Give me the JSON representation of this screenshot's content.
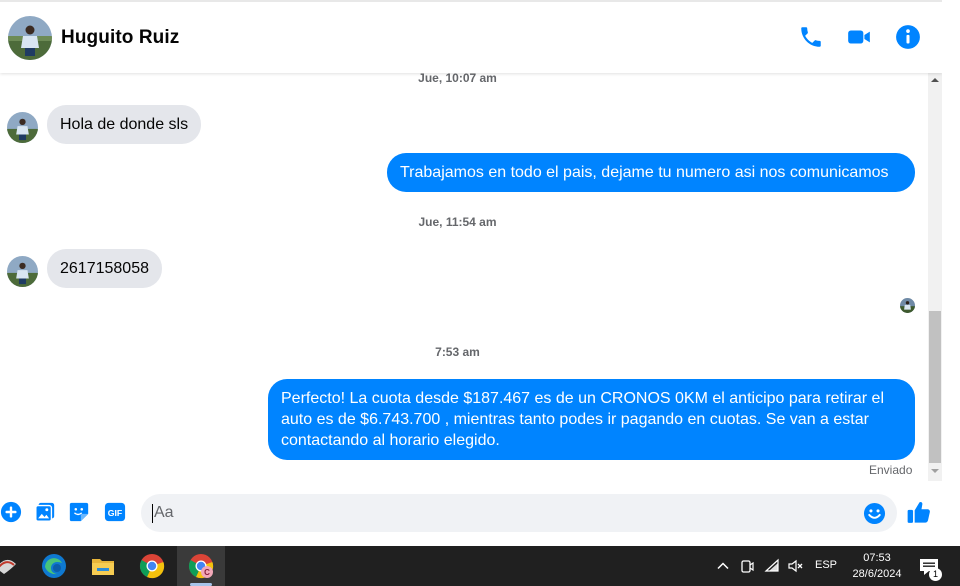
{
  "contact": {
    "name": "Huguito Ruiz"
  },
  "header_actions": [
    {
      "icon": "phone-icon"
    },
    {
      "icon": "video-camera-icon"
    },
    {
      "icon": "info-icon"
    }
  ],
  "messages": [
    {
      "type": "timestamp",
      "text": "Jue, 10:07 am"
    },
    {
      "type": "incoming",
      "text": "Hola de donde sls"
    },
    {
      "type": "outgoing",
      "text": "Trabajamos en todo el pais, dejame tu numero asi nos comunicamos"
    },
    {
      "type": "timestamp",
      "text": "Jue, 11:54 am"
    },
    {
      "type": "incoming",
      "text": "2617158058"
    },
    {
      "type": "timestamp",
      "text": "7:53 am"
    },
    {
      "type": "outgoing",
      "text": "Perfecto! La cuota desde $187.467 es de un CRONOS 0KM el anticipo para retirar el auto es de $6.743.700 , mientras tanto podes ir pagando en cuotas. Se van a estar contactando al horario elegido."
    }
  ],
  "status": {
    "sent": "Enviado"
  },
  "composer": {
    "placeholder": "Aa",
    "actions": [
      {
        "icon": "plus-circle-icon"
      },
      {
        "icon": "image-gallery-icon"
      },
      {
        "icon": "sticker-icon"
      },
      {
        "icon": "gif-icon",
        "label": "GIF"
      }
    ],
    "emoji_icon": "smiley-icon",
    "send_icon": "thumbs-up-icon"
  },
  "taskbar": {
    "apps": [
      {
        "icon": "pinned-app-icon"
      },
      {
        "icon": "edge-browser-icon"
      },
      {
        "icon": "file-explorer-icon"
      },
      {
        "icon": "chrome-browser-icon"
      },
      {
        "icon": "chrome-profile-icon",
        "badge": "C",
        "active": true
      }
    ],
    "tray": {
      "language": "ESP",
      "time": "07:53",
      "date": "28/6/2024",
      "notification_count": "1"
    }
  },
  "colors": {
    "accent": "#0084ff",
    "incoming_bubble": "#e4e6eb",
    "taskbar": "#202020"
  }
}
